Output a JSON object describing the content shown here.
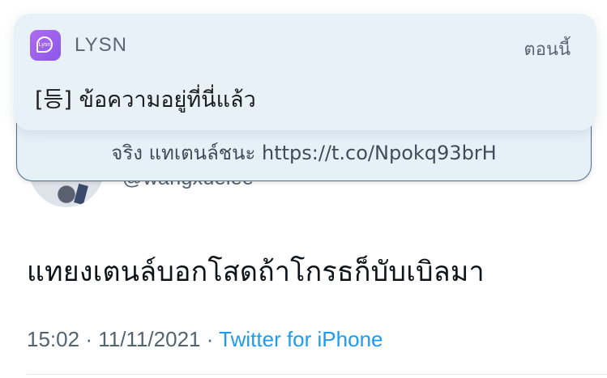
{
  "tweet": {
    "handle": "@wangxuelee",
    "text": "แทยงเตนล์บอกโสดถ้าโกรธก็บับเบิลมา",
    "time": "15:02",
    "separator": "·",
    "date": "11/11/2021",
    "source": "Twitter for iPhone"
  },
  "notifications": {
    "back": {
      "preview": "จริง แทเตนล์ชนะ https://t.co/Npokq93brH"
    },
    "front": {
      "app_name": "LYSN",
      "app_icon_text": "Lysn",
      "time": "ตอนนี้",
      "message": "[등] ข้อความอยู่ที่นี่แล้ว"
    }
  },
  "colors": {
    "link": "#1d9bf0",
    "app_icon": "#9b5ff0",
    "notification_bg": "#e9f1f8"
  }
}
